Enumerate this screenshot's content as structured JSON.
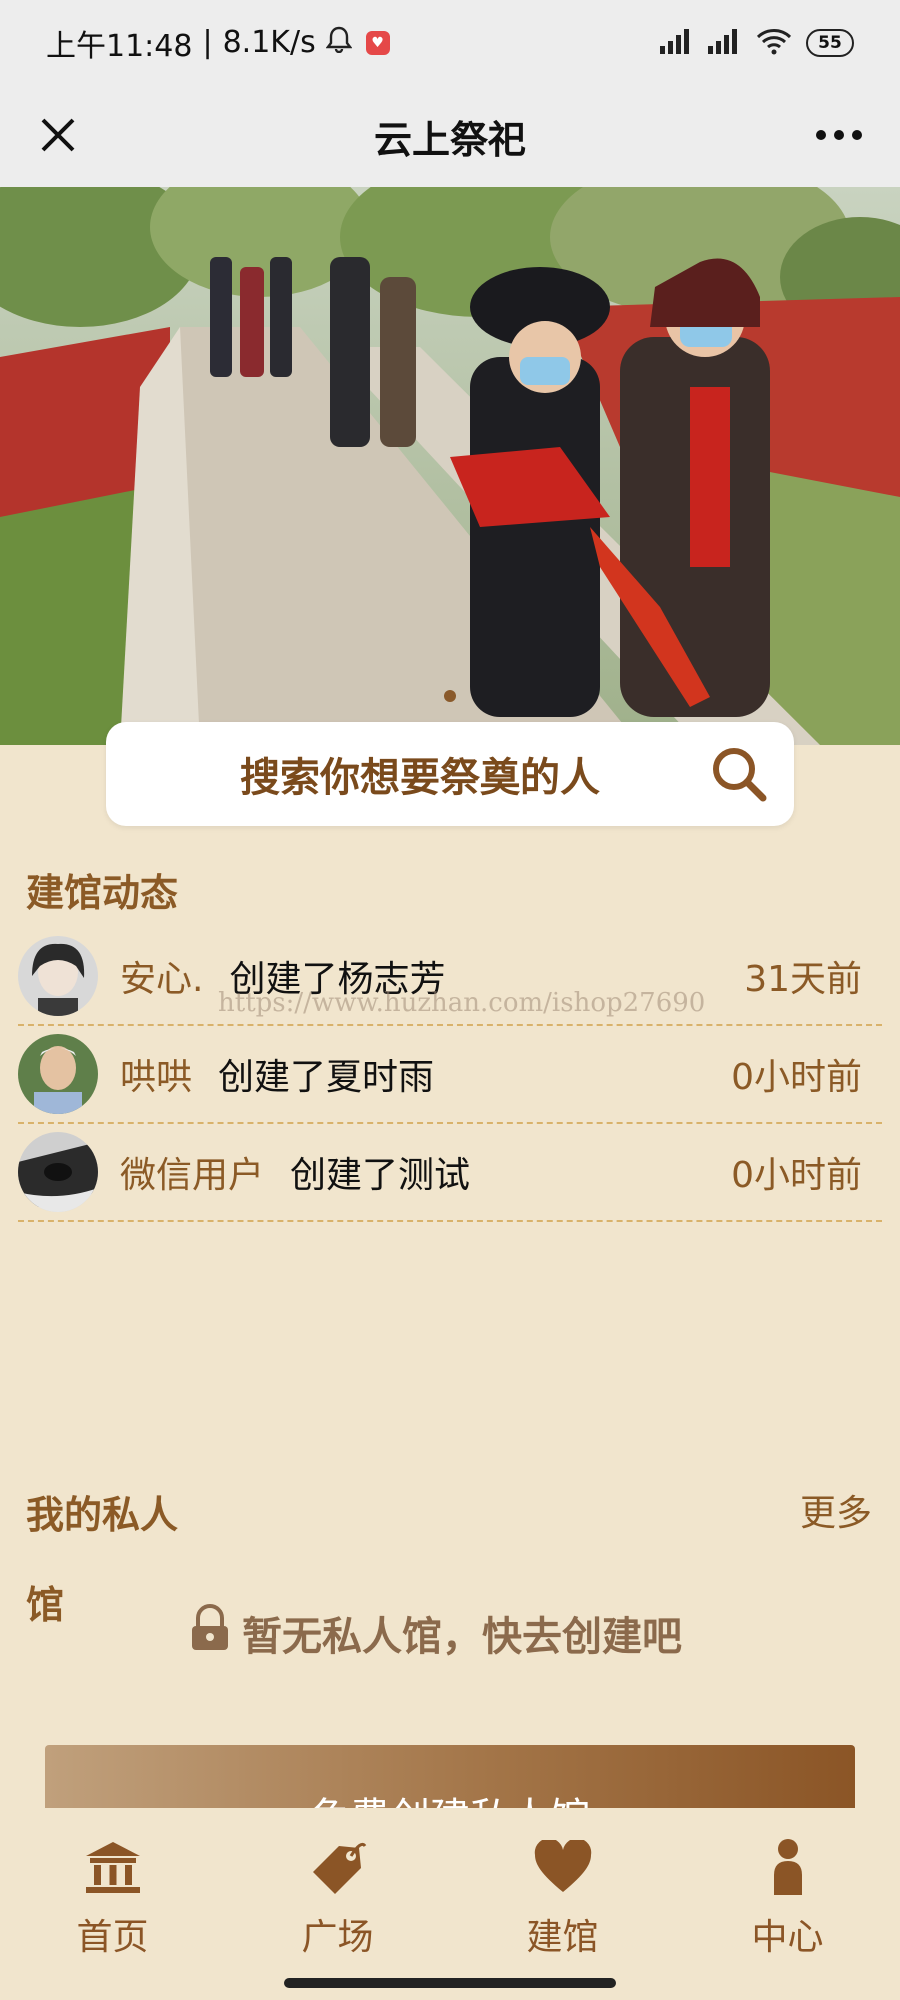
{
  "status_bar": {
    "time": "上午11:48",
    "net_speed": "8.1K/s",
    "battery": "55"
  },
  "header": {
    "title": "云上祭祀"
  },
  "search": {
    "placeholder": "搜索你想要祭奠的人"
  },
  "activity": {
    "title": "建馆动态",
    "items": [
      {
        "user": "安心.",
        "action": "创建了杨志芳",
        "time": "31天前"
      },
      {
        "user": "哄哄",
        "action": "创建了夏时雨",
        "time": "0小时前"
      },
      {
        "user": "微信用户",
        "action": "创建了测试",
        "time": "0小时前"
      }
    ],
    "watermark": "https://www.huzhan.com/ishop27690"
  },
  "private_hall": {
    "title_line1": "我的私人",
    "title_line2": "馆",
    "more": "更多",
    "empty_text": "暂无私人馆，快去创建吧",
    "create_button": "免费创建私人馆"
  },
  "nav": {
    "items": [
      {
        "label": "首页",
        "icon": "temple-icon"
      },
      {
        "label": "广场",
        "icon": "tag-icon"
      },
      {
        "label": "建馆",
        "icon": "heart-icon"
      },
      {
        "label": "中心",
        "icon": "person-icon"
      }
    ]
  },
  "colors": {
    "background": "#f1e5cd",
    "accent": "#8b5526",
    "divider": "#d9b26a"
  }
}
